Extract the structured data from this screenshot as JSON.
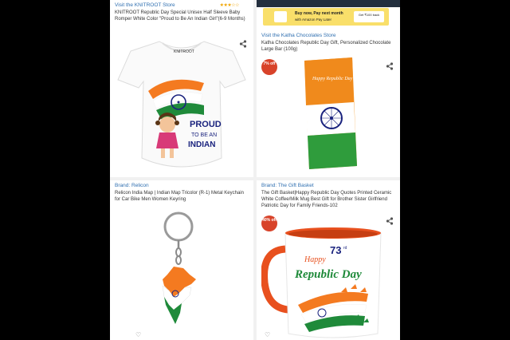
{
  "products": [
    {
      "store": "Visit the KNITROOT Store",
      "title": "KNITROOT Republic Day Special Unisex Half Sleeve Baby Romper White Color \"Proud to Be An Indian Girl\"(6-9 Months)",
      "rating": "★★★☆☆",
      "image": {
        "brand_print": "KNITROOT",
        "slogan_1": "PROUD",
        "slogan_2": "TO BE AN",
        "slogan_3": "INDIAN"
      }
    },
    {
      "store": "Visit the Katha Chocolates Store",
      "title": "Katha Chocolates Republic Day Gift, Personalized Chocolate Large Bar (100g)",
      "badge": "7% off",
      "banner": {
        "line1": "Buy now, Pay next month",
        "line2": "with Amazon Pay Later",
        "pill": "Get ₹100 back"
      },
      "image": {
        "wrapper_text": "Happy Republic Day"
      }
    },
    {
      "store": "Brand: Relicon",
      "title": "Relicon India Map | Indian Map Tricolor (R-1) Metal Keychain for Car Bike Men Women Keyring"
    },
    {
      "store": "Brand: The Gift Basket",
      "title": "The Gift Basket|Happy Republic Day Quotes Printed Ceramic White Coffee/Milk Mug Best Gift for Brother Sister Girlfriend Patriotic Day for Family Friends-102",
      "badge": "40% off",
      "image": {
        "line_top": "Happy",
        "number": "73",
        "sup": "rd",
        "line_main": "Republic Day"
      }
    }
  ],
  "colors": {
    "saffron": "#f47a20",
    "green": "#1f8a3a",
    "navy": "#1a237e",
    "link": "#2f6fb0",
    "deal": "#d8432a"
  },
  "icons": [
    "share-icon",
    "heart-icon",
    "ashoka-chakra-icon"
  ]
}
